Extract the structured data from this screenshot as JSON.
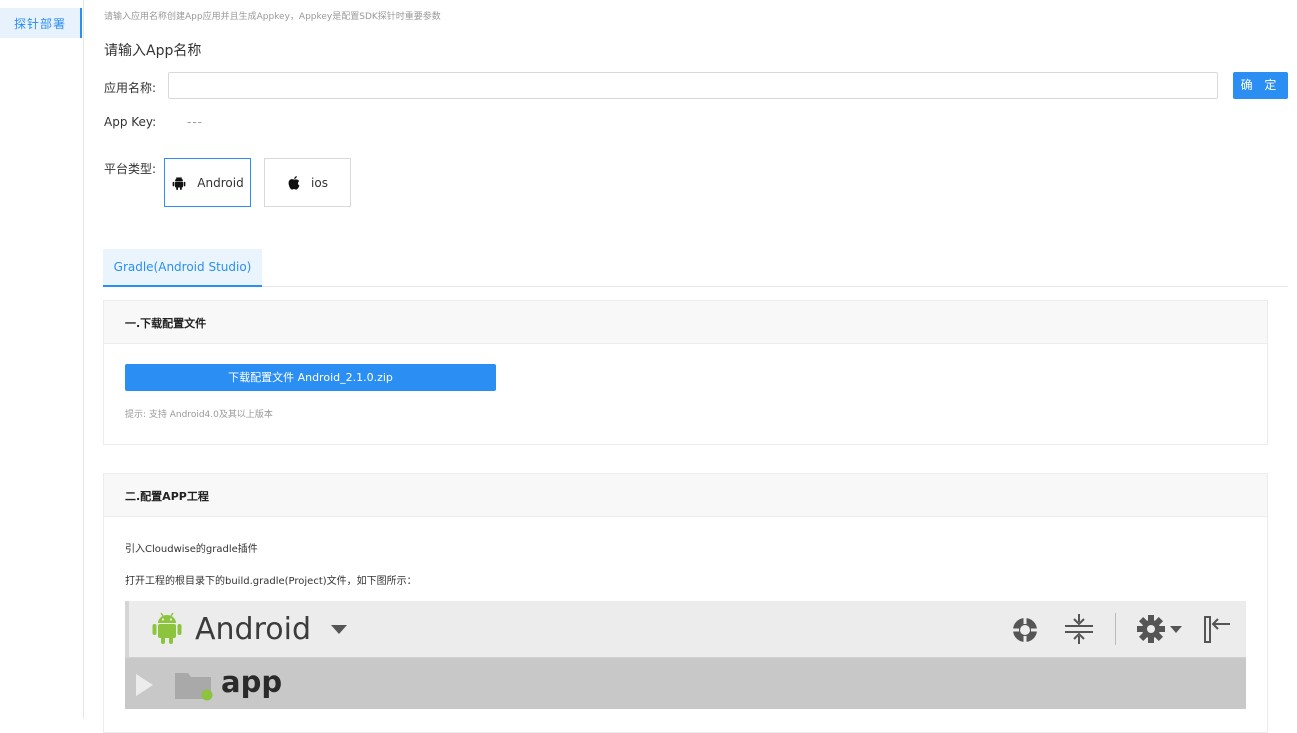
{
  "sidebar": {
    "items": [
      {
        "label": "探针部署",
        "active": true
      }
    ]
  },
  "header": {
    "hint": "请输入应用名称创建App应用并且生成Appkey，Appkey是配置SDK探针时重要参数",
    "title": "请输入App名称"
  },
  "form": {
    "app_name_label": "应用名称:",
    "app_name_value": "",
    "app_name_placeholder": "",
    "confirm_label": "确 定",
    "app_key_label": "App Key:",
    "app_key_value": "---",
    "platform_label": "平台类型:",
    "platforms": [
      {
        "label": "Android",
        "icon": "android-icon",
        "selected": true
      },
      {
        "label": "ios",
        "icon": "apple-icon",
        "selected": false
      }
    ]
  },
  "tabs": [
    {
      "label": "Gradle(Android Studio)",
      "active": true
    }
  ],
  "step1": {
    "title": "一.下载配置文件",
    "download_label": "下载配置文件 Android_2.1.0.zip",
    "hint": "提示: 支持 Android4.0及其以上版本"
  },
  "step2": {
    "title": "二.配置APP工程",
    "line1": "引入Cloudwise的gradle插件",
    "line2": "打开工程的根目录下的build.gradle(Project)文件，如下图所示：",
    "screenshot": {
      "project_view": "Android",
      "module": "app",
      "icons": [
        "android-icon",
        "dropdown-arrow-icon",
        "target-icon",
        "collapse-icon",
        "gear-icon",
        "dropdown-arrow-icon",
        "pin-left-icon",
        "expand-arrow-icon",
        "folder-icon"
      ]
    }
  },
  "colors": {
    "accent": "#2b8ef3",
    "android_green": "#8cc43e"
  }
}
